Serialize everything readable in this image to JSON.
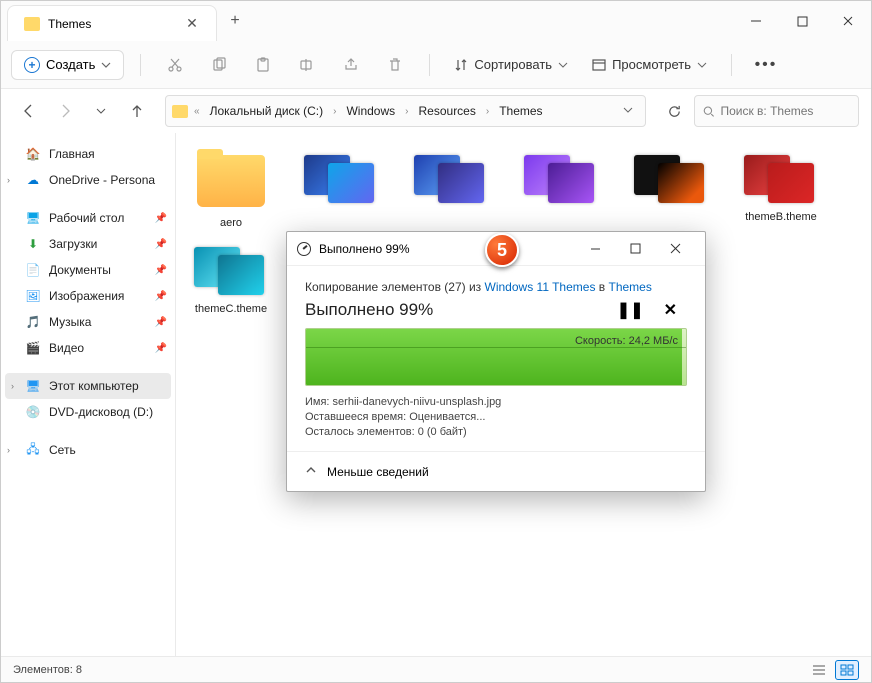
{
  "titlebar": {
    "tab_title": "Themes"
  },
  "toolbar": {
    "create": "Создать",
    "sort": "Сортировать",
    "view": "Просмотреть"
  },
  "breadcrumb": {
    "items": [
      "Локальный диск (C:)",
      "Windows",
      "Resources",
      "Themes"
    ]
  },
  "search": {
    "placeholder": "Поиск в: Themes"
  },
  "sidebar": {
    "home": "Главная",
    "onedrive": "OneDrive - Persona",
    "desktop": "Рабочий стол",
    "downloads": "Загрузки",
    "documents": "Документы",
    "pictures": "Изображения",
    "music": "Музыка",
    "videos": "Видео",
    "thispc": "Этот компьютер",
    "dvd": "DVD-дисковод (D:)",
    "network": "Сеть"
  },
  "files": {
    "aero": "aero",
    "themeB": "themeB.theme",
    "themeC": "themeC.theme"
  },
  "statusbar": {
    "count": "Элементов: 8"
  },
  "copy": {
    "title": "Выполнено 99%",
    "line_prefix": "Копирование элементов (27) из ",
    "src": "Windows 11 Themes",
    "mid": " в ",
    "dst": "Themes",
    "heading": "Выполнено 99%",
    "speed": "Скорость: 24,2 МБ/с",
    "name_label": "Имя:",
    "name_value": "serhii-danevych-niivu-unsplash.jpg",
    "time_label": "Оставшееся время:",
    "time_value": "Оценивается...",
    "items_label": "Осталось элементов:",
    "items_value": "0 (0 байт)",
    "less": "Меньше сведений"
  },
  "badge": "5"
}
